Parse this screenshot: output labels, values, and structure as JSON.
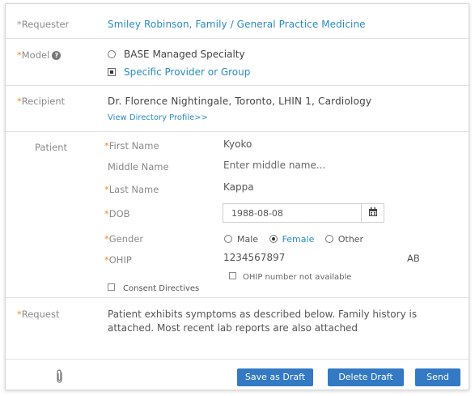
{
  "requester": {
    "label": "Requester",
    "value": "Smiley Robinson, Family / General Practice Medicine"
  },
  "model": {
    "label": "Model",
    "help_icon": "question-circle-icon",
    "options": [
      {
        "label": "BASE Managed Specialty",
        "selected": false
      },
      {
        "label": "Specific Provider or Group",
        "selected": true
      }
    ]
  },
  "recipient": {
    "label": "Recipient",
    "value": "Dr. Florence Nightingale, Toronto, LHIN 1, Cardiology",
    "link": "View Directory Profile>>"
  },
  "patient": {
    "label": "Patient",
    "first_name": {
      "label": "First Name",
      "value": "Kyoko"
    },
    "middle_name": {
      "label": "Middle Name",
      "placeholder": "Enter middle name..."
    },
    "last_name": {
      "label": "Last Name",
      "value": "Kappa"
    },
    "dob": {
      "label": "DOB",
      "value": "1988-08-08",
      "icon": "calendar-icon"
    },
    "gender": {
      "label": "Gender",
      "options": [
        {
          "label": "Male",
          "selected": false
        },
        {
          "label": "Female",
          "selected": true
        },
        {
          "label": "Other",
          "selected": false
        }
      ]
    },
    "ohip": {
      "label": "OHIP",
      "value": "1234567897",
      "province": "AB",
      "not_available_label": "OHIP number not available"
    },
    "consent_label": "Consent Directives"
  },
  "request": {
    "label": "Request",
    "text": "Patient exhibits symptoms as described below. Family history is attached. Most recent lab reports are also attached"
  },
  "actions": {
    "attach_icon": "paperclip-icon",
    "save_draft": "Save as Draft",
    "delete_draft": "Delete Draft",
    "send": "Send"
  },
  "colors": {
    "accent": "#2a8bc4",
    "required": "#e8902c",
    "button": "#3379c4"
  }
}
